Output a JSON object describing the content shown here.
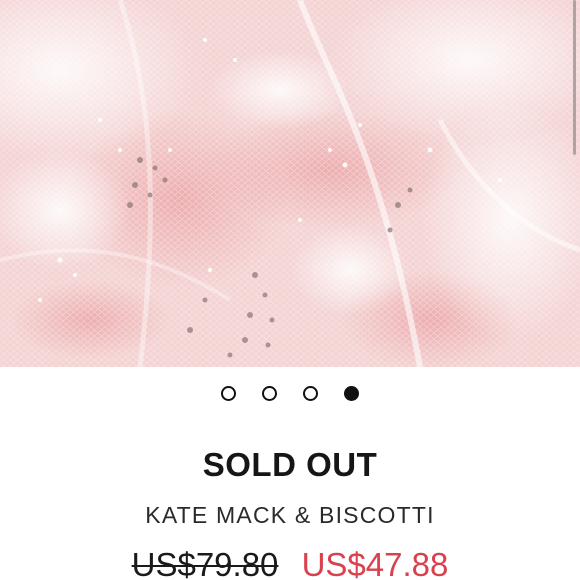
{
  "product": {
    "status": "SOLD OUT",
    "brand": "KATE MACK & BISCOTTI",
    "price_original": "US$79.80",
    "price_sale": "US$47.88"
  },
  "carousel": {
    "slide_count": 4,
    "active_index": 4
  },
  "colors": {
    "background": "#ffffff",
    "hero_pink": "#f3cfcf",
    "sale_price": "#d9414f",
    "text_dark": "#161616"
  }
}
